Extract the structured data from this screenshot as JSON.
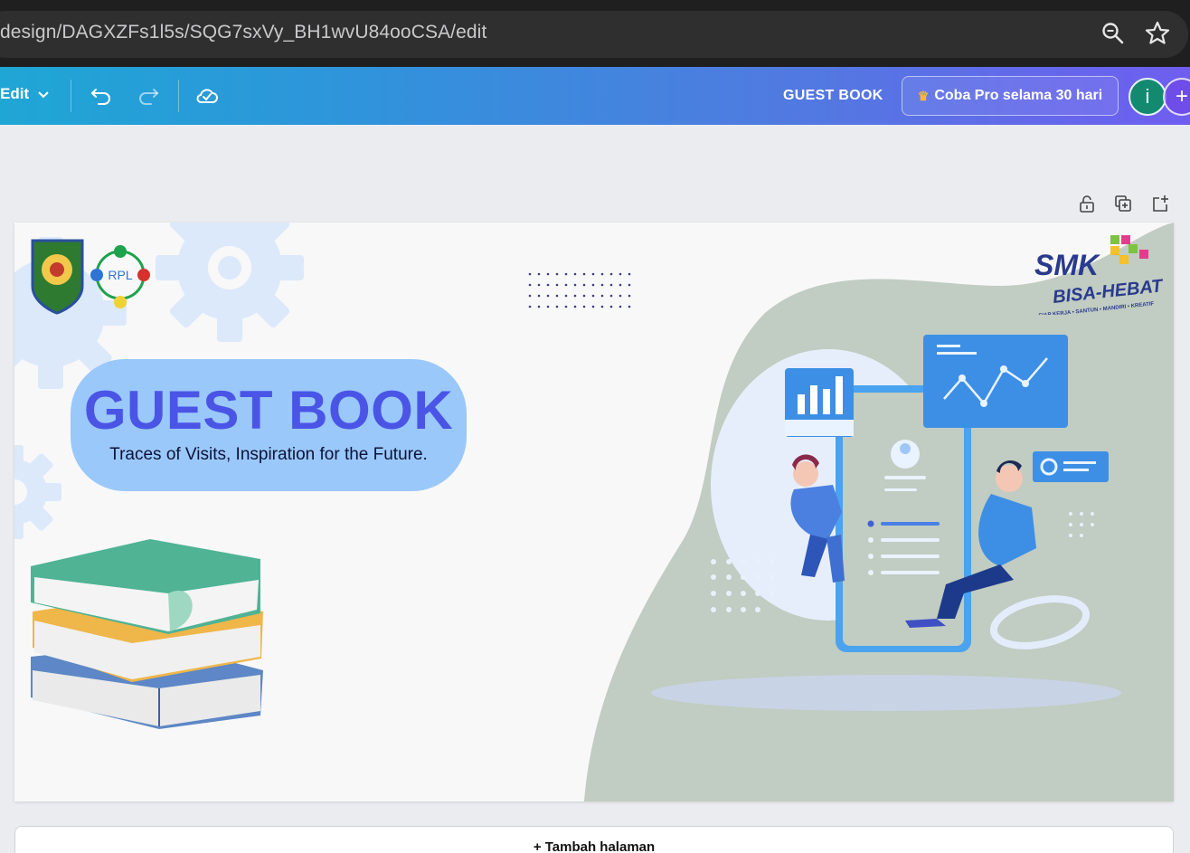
{
  "browser": {
    "url": "design/DAGXZFs1l5s/SQG7sxVy_BH1wvU84ooCSA/edit",
    "icons": [
      "zoom-icon",
      "bookmark-star-icon"
    ]
  },
  "toolbar": {
    "edit_label": "Edit",
    "design_title": "GUEST BOOK",
    "pro_label": "Coba Pro selama 30 hari",
    "avatar_initial": "i",
    "plus_label": "+",
    "icons": [
      "undo-icon",
      "redo-icon",
      "cloud-save-icon",
      "chevron-down-icon",
      "crown-icon"
    ],
    "colors": {
      "gradient_start": "#1fa6d5",
      "gradient_end": "#6f5ef0",
      "avatar": "#138a6f"
    }
  },
  "page_actions": {
    "icons": [
      "lock-icon",
      "duplicate-icon",
      "add-page-icon"
    ]
  },
  "canvas": {
    "title": "GUEST BOOK",
    "subtitle": "Traces of Visits, Inspiration for the Future.",
    "logo_smk": {
      "word1": "SMK",
      "word2": "BISA-HEBAT",
      "tagline": "SIAP KERJA • SANTUN • MANDIRI • KREATIF"
    },
    "logo_rpl": "RPL",
    "colors": {
      "title": "#4a55e6",
      "pill": "#9ac8fa",
      "blob": "#c1ccc2",
      "gear": "#dce9fb"
    }
  },
  "add_page_label": "+ Tambah halaman"
}
